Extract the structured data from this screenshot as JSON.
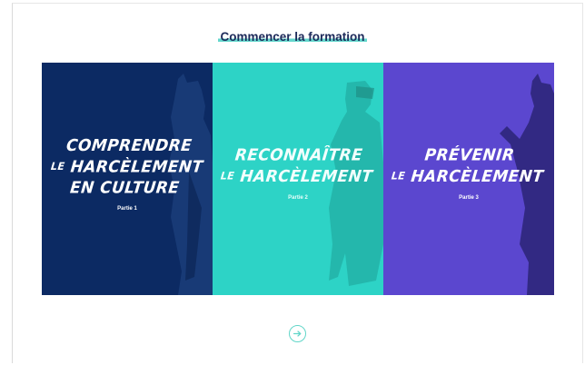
{
  "heading": "Commencer la formation",
  "cards": [
    {
      "line1": "COMPRENDRE",
      "line2_small": "LE",
      "line2": "HARCÈLEMENT",
      "line3": "EN CULTURE",
      "part": "Partie 1",
      "color": "#0c2a63"
    },
    {
      "line1": "RECONNAÎTRE",
      "line2_small": "LE",
      "line2": "HARCÈLEMENT",
      "part": "Partie 2",
      "color": "#2dd3c6"
    },
    {
      "line1": "PRÉVENIR",
      "line2_small": "LE",
      "line2": "HARCÈLEMENT",
      "part": "Partie 3",
      "color": "#5b47cf"
    }
  ],
  "start_button": {
    "icon": "arrow-right-icon",
    "accent": "#62d6c9"
  }
}
